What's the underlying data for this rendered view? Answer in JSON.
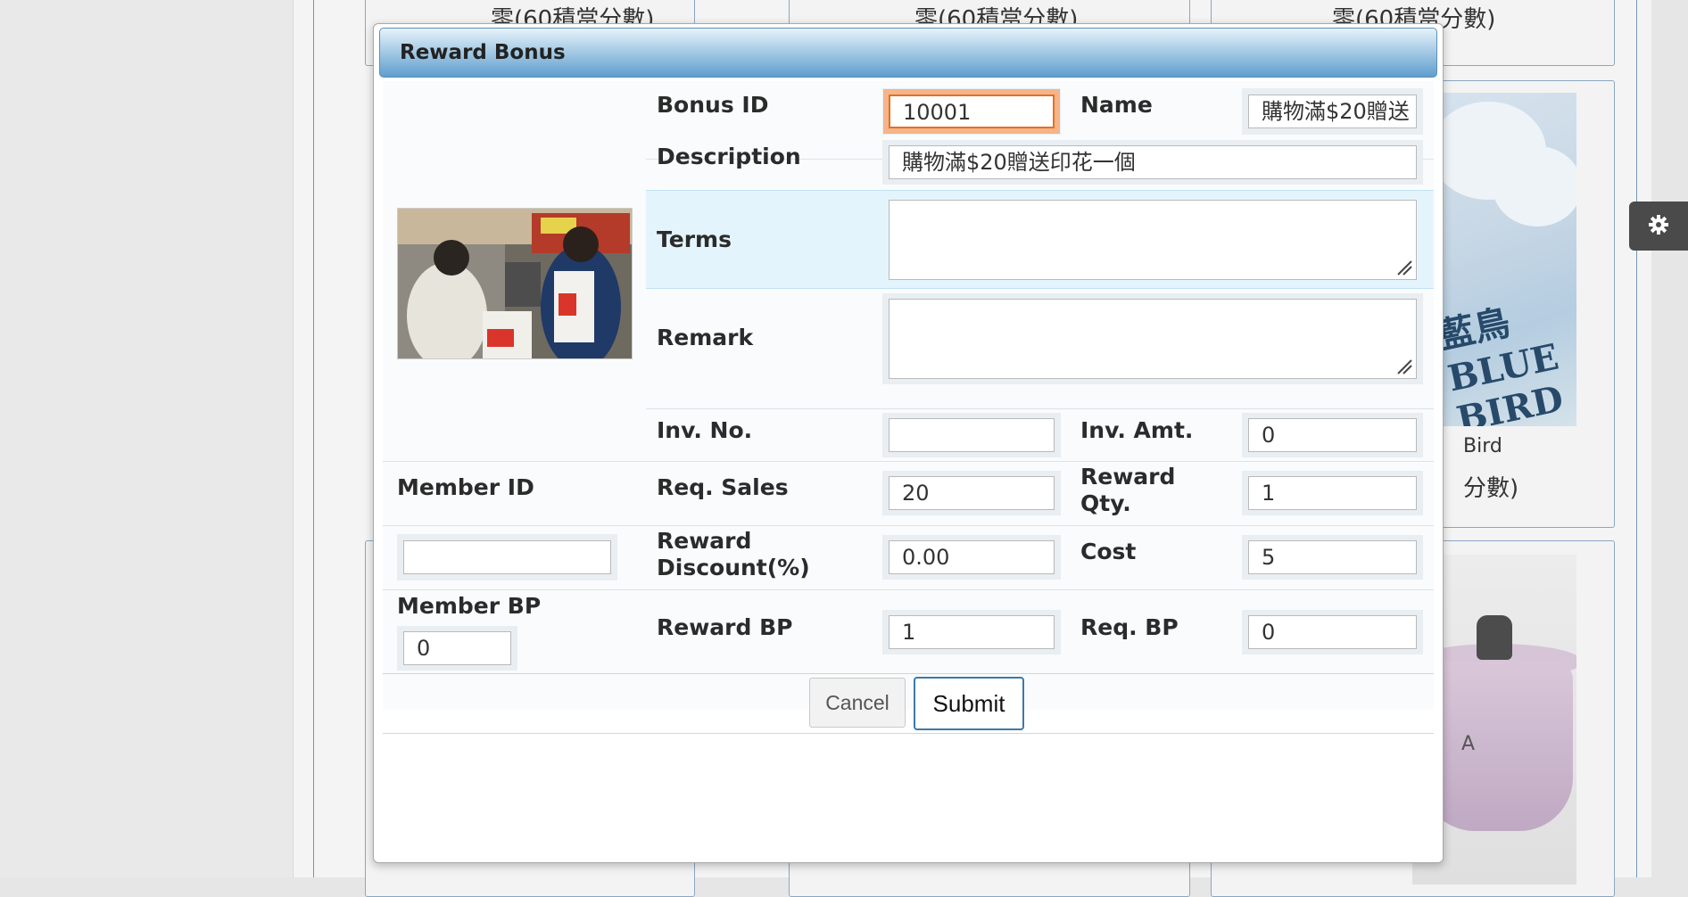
{
  "background": {
    "card_texts": [
      "零(60積當分數)",
      "零(60積當分數)",
      "零(60積當分數)",
      "Bird",
      "分數)"
    ],
    "bird_logo": "藍鳥 BLUE BIRD",
    "pot_mark": "A"
  },
  "settings": {
    "icon": "gear-icon"
  },
  "modal": {
    "title": "Reward Bonus",
    "labels": {
      "bonus_id": "Bonus ID",
      "name": "Name",
      "description": "Description",
      "terms": "Terms",
      "remark": "Remark",
      "inv_no": "Inv. No.",
      "inv_amt": "Inv. Amt.",
      "member_id": "Member ID",
      "req_sales": "Req. Sales",
      "reward_qty": "Reward Qty.",
      "reward_discount": "Reward Discount(%)",
      "cost": "Cost",
      "member_bp": "Member BP",
      "reward_bp": "Reward BP",
      "req_bp": "Req. BP"
    },
    "values": {
      "bonus_id": "10001",
      "name": "購物滿$20贈送",
      "description": "購物滿$20贈送印花一個",
      "terms": "",
      "remark": "",
      "inv_no": "",
      "inv_amt": "0",
      "member_id": "",
      "req_sales": "20",
      "reward_qty": "1",
      "reward_discount": "0.00",
      "cost": "5",
      "member_bp": "0",
      "reward_bp": "1",
      "req_bp": "0"
    },
    "buttons": {
      "cancel": "Cancel",
      "submit": "Submit"
    }
  }
}
